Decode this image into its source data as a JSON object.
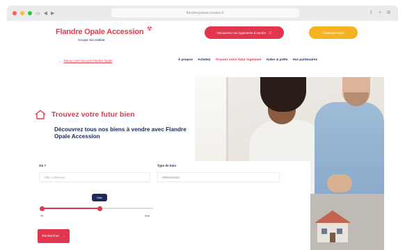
{
  "browser": {
    "url": "flandreopaleaccession.fr",
    "controls": {
      "back": "◀",
      "forward": "▶",
      "reload": "⟳",
      "sidebar": "▭"
    },
    "right_icons": "⇪ + ⧉",
    "dot_colors": [
      "#ff5f57",
      "#febc2e",
      "#28c840"
    ]
  },
  "header": {
    "logo_text": "Flandre Opale Accession",
    "logo_tagline": "Groupe Sia Habitat",
    "cta_primary": "Découvrez nos logements à vendre",
    "cta_secondary": "Contactez-nous",
    "accent": "#e2364f",
    "yellow": "#f5b221"
  },
  "subnav": {
    "back_label": "Retour vers l'accueil Flandre Opale",
    "items": [
      {
        "label": "À propos",
        "active": false
      },
      {
        "label": "Achetez",
        "active": false
      },
      {
        "label": "Trouvez votre futur logement",
        "active": true
      },
      {
        "label": "Aides & prêts",
        "active": false
      },
      {
        "label": "Vos partenaires",
        "active": false
      }
    ]
  },
  "hero": {
    "title": "Trouvez votre futur bien",
    "subtitle": "Découvrez tous nos biens à vendre avec Flandre Opale Accession"
  },
  "search": {
    "city_label": "Où ?",
    "city_placeholder": "Ville, commune",
    "type_label": "Type de bien",
    "type_value": "Sélectionner",
    "budget_bubble": "Max",
    "budget_fraction": 0.52,
    "min_label": "0€",
    "max_label": "Max",
    "submit_label": "Rechercher"
  }
}
